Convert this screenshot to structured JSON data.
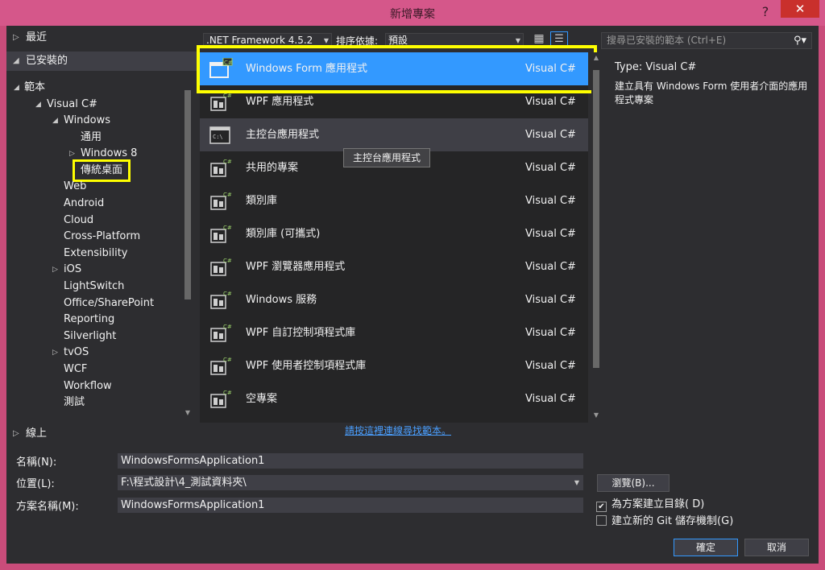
{
  "window": {
    "title": "新增專案",
    "help": "?",
    "close": "✕"
  },
  "tree": {
    "recent": "最近",
    "installed": "已安裝的",
    "online": "線上",
    "nodes": [
      {
        "label": "範本",
        "expanded": true
      },
      {
        "label": "Visual C#",
        "expanded": true
      },
      {
        "label": "Windows",
        "expanded": true
      },
      {
        "label": "通用"
      },
      {
        "label": "Windows 8",
        "expandable": true
      },
      {
        "label": "傳統桌面",
        "selected": true
      },
      {
        "label": "Web"
      },
      {
        "label": "Android"
      },
      {
        "label": "Cloud"
      },
      {
        "label": "Cross-Platform"
      },
      {
        "label": "Extensibility"
      },
      {
        "label": "iOS",
        "expandable": true
      },
      {
        "label": "LightSwitch"
      },
      {
        "label": "Office/SharePoint"
      },
      {
        "label": "Reporting"
      },
      {
        "label": "Silverlight"
      },
      {
        "label": "tvOS",
        "expandable": true
      },
      {
        "label": "WCF"
      },
      {
        "label": "Workflow"
      },
      {
        "label": "測試"
      }
    ]
  },
  "toolbar": {
    "framework": ".NET Framework 4.5.2",
    "sort_label": "排序依據:",
    "sort_value": "預設"
  },
  "templates": [
    {
      "name": "Windows Form 應用程式",
      "lang": "Visual C#",
      "icon": "windows-form-icon",
      "selected": true
    },
    {
      "name": "WPF 應用程式",
      "lang": "Visual C#",
      "icon": "wpf-app-icon"
    },
    {
      "name": "主控台應用程式",
      "lang": "Visual C#",
      "icon": "console-app-icon",
      "hovered": true
    },
    {
      "name": "共用的專案",
      "lang": "Visual C#",
      "icon": "shared-project-icon"
    },
    {
      "name": "類別庫",
      "lang": "Visual C#",
      "icon": "class-library-icon"
    },
    {
      "name": "類別庫 (可攜式)",
      "lang": "Visual C#",
      "icon": "portable-class-library-icon"
    },
    {
      "name": "WPF 瀏覽器應用程式",
      "lang": "Visual C#",
      "icon": "wpf-browser-app-icon"
    },
    {
      "name": "Windows 服務",
      "lang": "Visual C#",
      "icon": "windows-service-icon"
    },
    {
      "name": "WPF 自訂控制項程式庫",
      "lang": "Visual C#",
      "icon": "wpf-custom-control-icon"
    },
    {
      "name": "WPF 使用者控制項程式庫",
      "lang": "Visual C#",
      "icon": "wpf-user-control-icon"
    },
    {
      "name": "空專案",
      "lang": "Visual C#",
      "icon": "empty-project-icon"
    }
  ],
  "tooltip": "主控台應用程式",
  "online_link": "請按這裡連線尋找範本。",
  "search": {
    "placeholder": "搜尋已安裝的範本 (Ctrl+E)"
  },
  "details": {
    "type": "Type:  Visual C#",
    "description": "建立具有 Windows Form 使用者介面的應用程式專案"
  },
  "form": {
    "name_label": "名稱(N):",
    "name_value": "WindowsFormsApplication1",
    "location_label": "位置(L):",
    "location_value": "F:\\程式設計\\4_測試資料夾\\",
    "solution_label": "方案名稱(M):",
    "solution_value": "WindowsFormsApplication1",
    "browse": "瀏覽(B)...",
    "create_dir": "為方案建立目錄( D)",
    "create_dir_checked": true,
    "git": "建立新的 Git 儲存機制(G)",
    "git_checked": false,
    "ok": "確定",
    "cancel": "取消"
  },
  "colors": {
    "accent": "#3399ff",
    "highlight": "#ffff00",
    "chrome": "#d5578a",
    "background": "#2d2d30"
  }
}
